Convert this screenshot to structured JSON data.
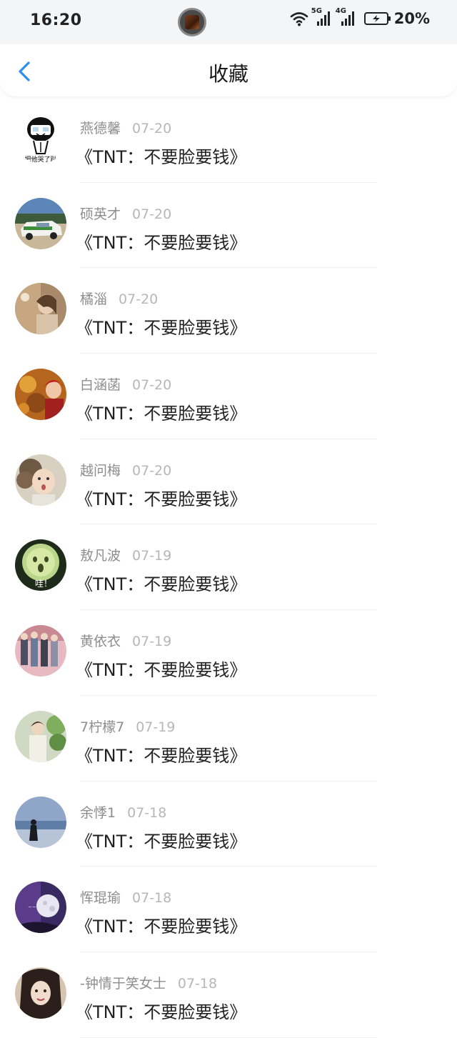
{
  "status_bar": {
    "time": "16:20",
    "battery_percent": "20%",
    "network_a": "5G",
    "network_b": "4G"
  },
  "header": {
    "title": "收藏",
    "back_icon": "chevron-left-icon",
    "accent_color": "#2f8ff0"
  },
  "items": [
    {
      "name": "燕德馨",
      "date": "07-20",
      "title": "《TNT：不要脸要钱》",
      "avatar_caption": "把他哭了趴"
    },
    {
      "name": "硕英才",
      "date": "07-20",
      "title": "《TNT：不要脸要钱》"
    },
    {
      "name": "橘淄",
      "date": "07-20",
      "title": "《TNT：不要脸要钱》"
    },
    {
      "name": "白涵菡",
      "date": "07-20",
      "title": "《TNT：不要脸要钱》"
    },
    {
      "name": "越问梅",
      "date": "07-20",
      "title": "《TNT：不要脸要钱》"
    },
    {
      "name": "敖凡波",
      "date": "07-19",
      "title": "《TNT：不要脸要钱》",
      "avatar_caption": "哇！"
    },
    {
      "name": "黄依衣",
      "date": "07-19",
      "title": "《TNT：不要脸要钱》"
    },
    {
      "name": "7柠檬7",
      "date": "07-19",
      "title": "《TNT：不要脸要钱》"
    },
    {
      "name": "余悸1",
      "date": "07-18",
      "title": "《TNT：不要脸要钱》"
    },
    {
      "name": "恽琨瑜",
      "date": "07-18",
      "title": "《TNT：不要脸要钱》"
    },
    {
      "name": "-钟情于笑女士",
      "date": "07-18",
      "title": "《TNT：不要脸要钱》"
    }
  ]
}
